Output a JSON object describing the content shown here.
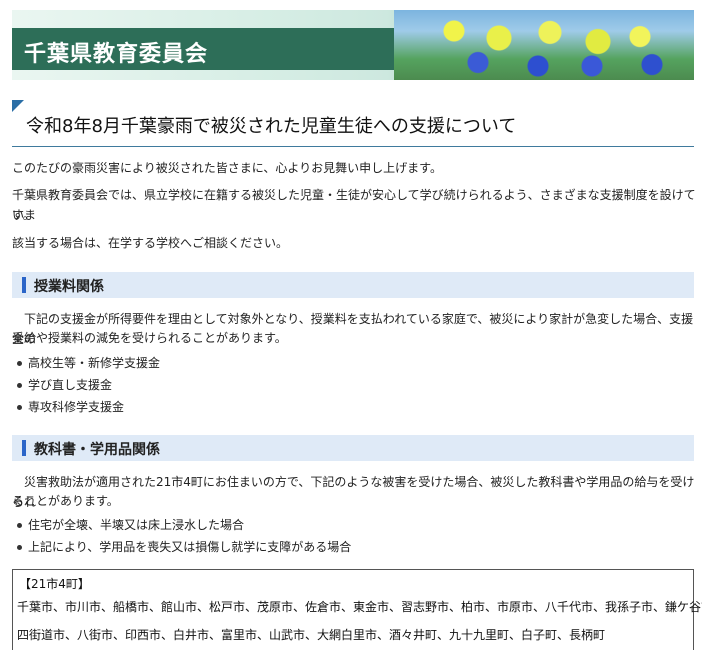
{
  "header": {
    "site_title": "千葉県教育委員会"
  },
  "page": {
    "title": "令和8年8月千葉豪雨で被災された児童生徒への支援について",
    "intro": [
      "このたびの豪雨災害により被災された皆さまに、心よりお見舞い申し上げます。",
      "千葉県教育委員会では、県立学校に在籍する被災した児童・生徒が安心して学び続けられるよう、さまざまな支援制度を設けていま",
      "す。",
      "該当する場合は、在学する学校へご相談ください。"
    ]
  },
  "sections": [
    {
      "heading": "授業料関係",
      "body_lines": [
        "下記の支援金が所得要件を理由として対象外となり、授業料を支払われている家庭で、被災により家計が急変した場合、支援金の",
        "受給や授業料の減免を受けられることがあります。"
      ],
      "items": [
        "高校生等・新修学支援金",
        "学び直し支援金",
        "専攻科修学支援金"
      ]
    },
    {
      "heading": "教科書・学用品関係",
      "body_lines": [
        "災害救助法が適用された21市4町にお住まいの方で、下記のような被害を受けた場合、被災した教科書や学用品の給与を受けられ",
        "ることがあります。"
      ],
      "items": [
        "住宅が全壊、半壊又は床上浸水した場合",
        "上記により、学用品を喪失又は損傷し就学に支障がある場合"
      ]
    }
  ],
  "municipalities_box": {
    "title": "【21市4町】",
    "lines": [
      "千葉市、市川市、船橋市、館山市、松戸市、茂原市、佐倉市、東金市、習志野市、柏市、市原市、八千代市、我孫子市、鎌ケ谷市、",
      "四街道市、八街市、印西市、白井市、富里市、山武市、大網白里市、酒々井町、九十九里町、白子町、長柄町"
    ]
  },
  "colors": {
    "banner_green": "#2d6e58",
    "section_bg": "#dfeaf7",
    "section_bar": "#2b65c8",
    "title_rule": "#3f7a9d"
  }
}
